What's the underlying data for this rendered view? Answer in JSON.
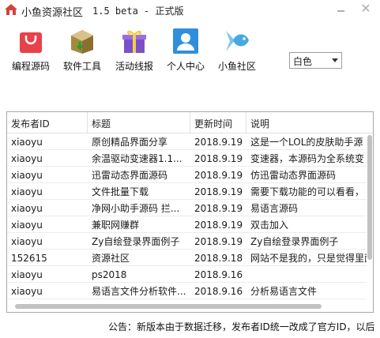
{
  "window": {
    "title": "小鱼资源社区",
    "version": "1.5 beta  - 正式版",
    "minimize_icon": "minimize-icon",
    "close_icon": "close-icon",
    "close_glyph": "✕"
  },
  "toolbar": {
    "buttons": [
      {
        "label": "编程源码",
        "icon": "shopping-bag-icon",
        "color": "#e8414a"
      },
      {
        "label": "软件工具",
        "icon": "package-box-icon",
        "color": "#a58a3e"
      },
      {
        "label": "活动线报",
        "icon": "gift-box-icon",
        "color": "#7b4fc9"
      },
      {
        "label": "个人中心",
        "icon": "user-profile-icon",
        "color": "#2f8fdc"
      },
      {
        "label": "小鱼社区",
        "icon": "fish-icon",
        "color": "#48a8e0"
      }
    ]
  },
  "theme_select": {
    "value": "白色"
  },
  "table": {
    "columns": [
      "发布者ID",
      "标题",
      "更新时间",
      "说明"
    ],
    "rows": [
      [
        "xiaoyu",
        "原创精品界面分享",
        "2018.9.19",
        "这是一个LOL的皮肤助手源"
      ],
      [
        "xiaoyu",
        "余温驱动变速器1.1...",
        "2018.9.19",
        "变速器，本源码为全系统变"
      ],
      [
        "xiaoyu",
        "迅雷动态界面源码",
        "2018.9.19",
        "仿迅雷动态界面源码"
      ],
      [
        "xiaoyu",
        "文件批量下载",
        "2018.9.19",
        "需要下载功能的可以看看，"
      ],
      [
        "xiaoyu",
        "净网小助手源码  拦...",
        "2018.9.19",
        "易语言源码"
      ],
      [
        "xiaoyu",
        "兼职网赚群",
        "2018.9.19",
        "双击加入"
      ],
      [
        "xiaoyu",
        "Zy自绘登录界面例子",
        "2018.9.19",
        "Zy自绘登录界面例子"
      ],
      [
        "152615",
        "资源社区",
        "2018.9.18",
        "网站不是我的，只是觉得里面"
      ],
      [
        "xiaoyu",
        "ps2018",
        "2018.9.16",
        ""
      ],
      [
        "xiaoyu",
        "易语言文件分析软件...",
        "2018.9.16",
        "分析易语言文件"
      ]
    ]
  },
  "notice": "公告：新版本由于数据迁移，发布者ID统一改成了官方ID，以后"
}
